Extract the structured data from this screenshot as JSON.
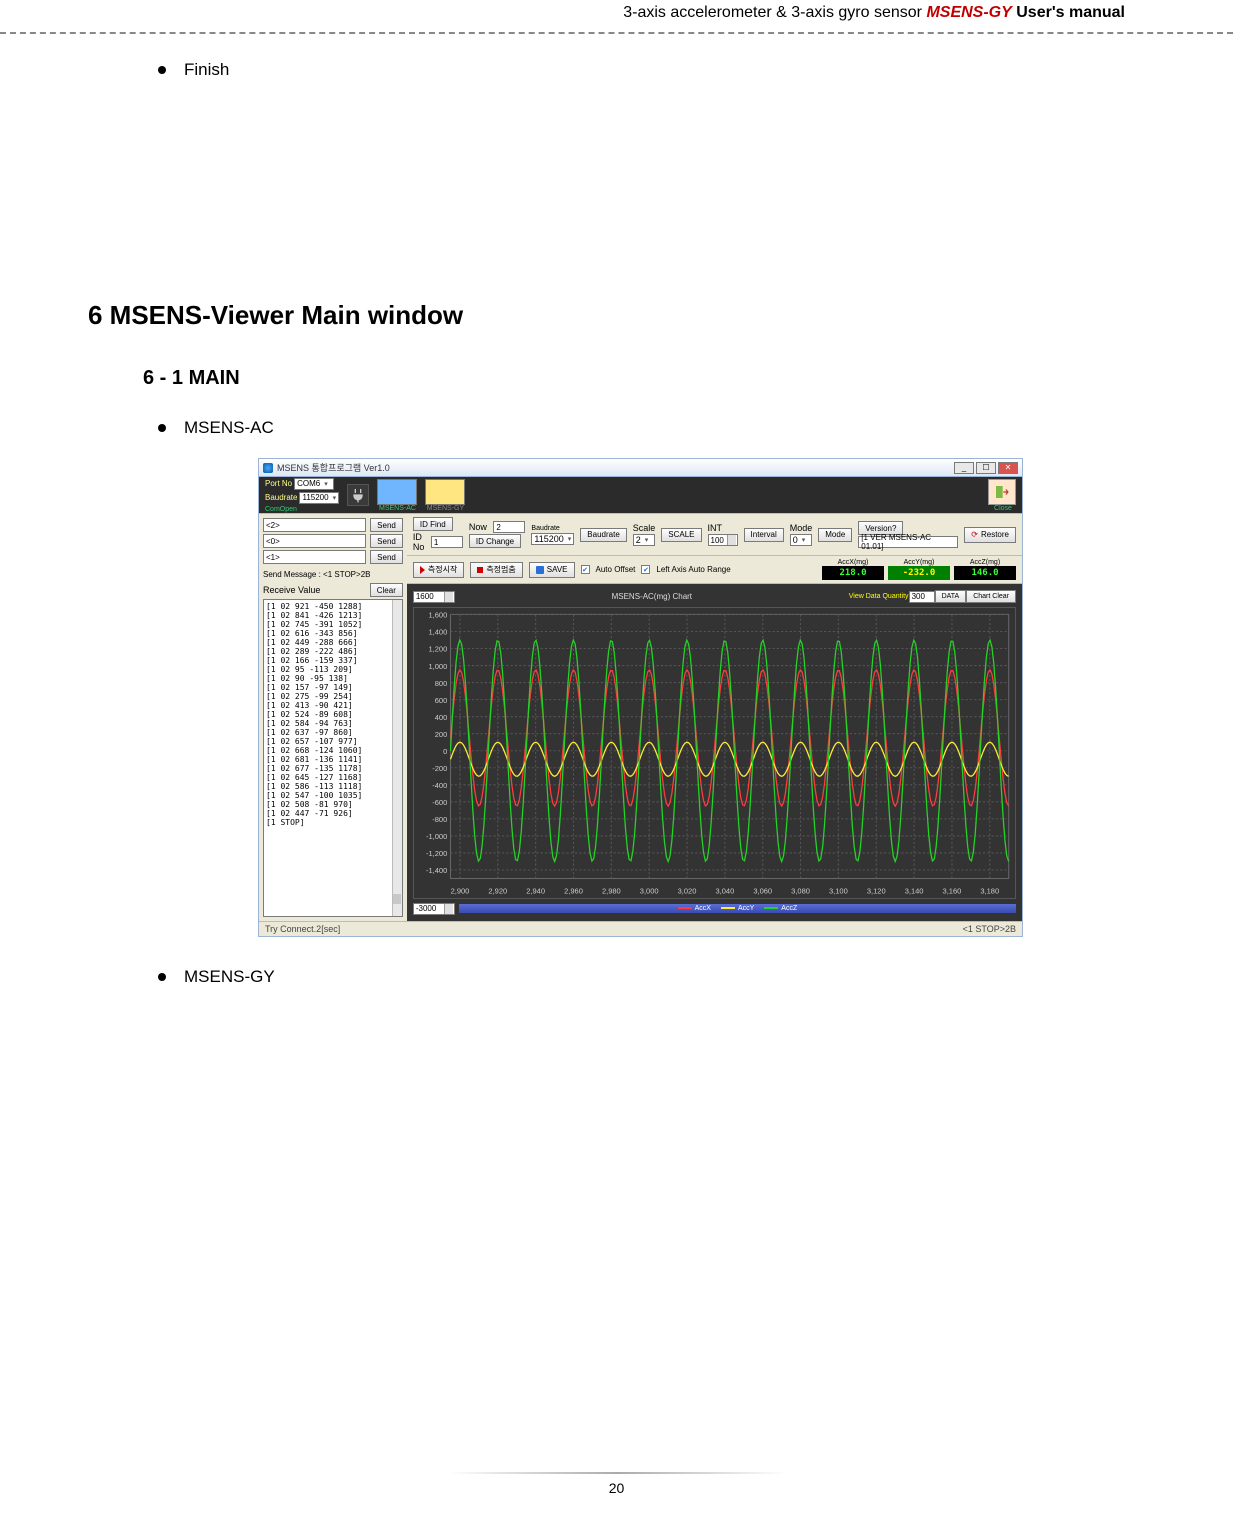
{
  "page_header": {
    "left": "3-axis accelerometer & 3-axis gyro sensor ",
    "product": "MSENS-GY",
    "right": "  User's manual"
  },
  "finish_bullet": "Finish",
  "section_title": "6  MSENS-Viewer Main window",
  "subsection_title": "6 - 1 MAIN",
  "bullet_ac": "MSENS-AC",
  "bullet_gy": "MSENS-GY",
  "page_number": "20",
  "app": {
    "title": "MSENS 통합프로그램 Ver1.0",
    "port_no_label": "Port No",
    "baudrate_label_top": "Baudrate",
    "port_no_value": "COM6",
    "baudrate_value_top": "115200",
    "com_open_label": "ComOpen",
    "tab_ac": "MSENS-AC",
    "tab_gy": "MSENS-GY",
    "close_label": "Close",
    "cmd2": "<2>",
    "cmd0": "<0>",
    "cmd1": "<1>",
    "send_btn": "Send",
    "send_msg_label": "Send Message : <1  STOP>2B",
    "recv_label": "Receive Value",
    "clear_btn": "Clear",
    "id_find_btn": "ID Find",
    "id_no_label": "ID No",
    "id_no_value": "1",
    "id_change_btn": "ID Change",
    "now_label": "Now",
    "now_value": "2",
    "baud_grp_label": "Baudrate",
    "baud_grp_value": "115200",
    "baud_btn": "Baudrate",
    "scale_label": "Scale",
    "scale_val": "2",
    "scale_btn": "SCALE",
    "int_label": "INT",
    "int_val": "100",
    "int_btn": "Interval",
    "mode_label": "Mode",
    "mode_val": "0",
    "mode_btn": "Mode",
    "version_btn": "Version?",
    "version_text": "[1 VER MSENS-AC 01.01]",
    "restore_btn": "Restore",
    "start_btn": "측정시작",
    "stop_btn": "측정멈춤",
    "save_btn": "SAVE",
    "auto_offset": "Auto Offset",
    "left_axis_auto": "Left Axis Auto Range",
    "accx_label": "AccX(mg)",
    "accy_label": "AccY(mg)",
    "accz_label": "AccZ(mg)",
    "accx_val": "218.0",
    "accy_val": "-232.0",
    "accz_val": "146.0",
    "chart_title": "MSENS-AC(mg) Chart",
    "view_qty_label": "View Data Quantity",
    "view_qty_val": "300",
    "data_btn": "DATA",
    "chart_clear_btn": "Chart Clear",
    "y_top_spin": "1600",
    "y_bot_spin": "-3000",
    "legend": {
      "x": "AccX",
      "y": "AccY",
      "z": "AccZ"
    },
    "status_left": "Try Connect.2[sec]",
    "status_right": "<1  STOP>2B",
    "recv_lines": [
      "[1 02 921 -450 1288]",
      "[1 02 841 -426 1213]",
      "[1 02 745 -391 1052]",
      "[1 02 616 -343 856]",
      "[1 02 449 -288 666]",
      "[1 02 289 -222 486]",
      "[1 02 166 -159 337]",
      "[1 02 95 -113 209]",
      "[1 02 90 -95 138]",
      "[1 02 157 -97 149]",
      "[1 02 275 -99 254]",
      "[1 02 413 -90 421]",
      "[1 02 524 -89 608]",
      "[1 02 584 -94 763]",
      "[1 02 637 -97 860]",
      "[1 02 657 -107 977]",
      "[1 02 668 -124 1060]",
      "[1 02 681 -136 1141]",
      "[1 02 677 -135 1178]",
      "[1 02 645 -127 1168]",
      "[1 02 586 -113 1118]",
      "[1 02 547 -100 1035]",
      "[1 02 508 -81 970]",
      "[1 02 447 -71 926]",
      "[1 STOP]"
    ]
  },
  "chart_data": {
    "type": "line",
    "title": "MSENS-AC(mg) Chart",
    "xlabel": "",
    "ylabel": "",
    "xlim": [
      2895,
      3190
    ],
    "ylim": [
      -1500,
      1600
    ],
    "xticks": [
      2900,
      2920,
      2940,
      2960,
      2980,
      3000,
      3020,
      3040,
      3060,
      3080,
      3100,
      3120,
      3140,
      3160,
      3180
    ],
    "yticks": [
      -1400,
      -1200,
      -1000,
      -800,
      -600,
      -400,
      -200,
      0,
      200,
      400,
      600,
      800,
      1000,
      1200,
      1400,
      1600
    ],
    "series": [
      {
        "name": "AccX",
        "color": "#ff3b3b",
        "amplitude": 800,
        "offset": 150,
        "period": 20
      },
      {
        "name": "AccY",
        "color": "#ffeb3b",
        "amplitude": 200,
        "offset": -100,
        "period": 20
      },
      {
        "name": "AccZ",
        "color": "#24d324",
        "amplitude": 1300,
        "offset": 0,
        "period": 20
      }
    ]
  }
}
